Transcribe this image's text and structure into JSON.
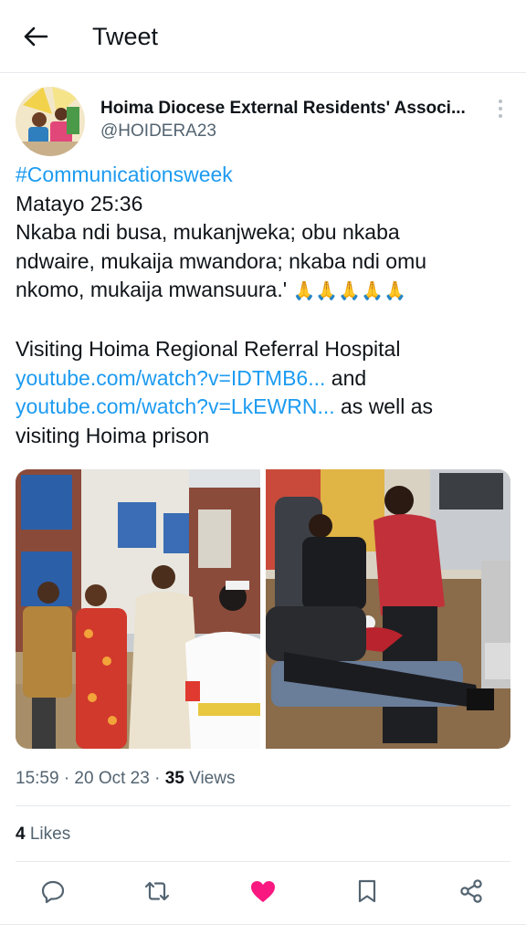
{
  "header": {
    "title": "Tweet",
    "back_icon": "arrow-left-icon"
  },
  "author": {
    "name": "Hoima Diocese External Residents' Associ...",
    "handle": "@HOIDERA23"
  },
  "tweet": {
    "hashtag": "#Communicationsweek",
    "line1": "Matayo 25:36",
    "line2": "Nkaba ndi busa, mukanjweka; obu nkaba",
    "line3": "ndwaire, mukaija mwandora; nkaba ndi omu",
    "line4": "nkomo, mukaija mwansuura.'",
    "emoji": "🙏🙏🙏🙏🙏",
    "line5": " Visiting Hoima Regional Referral Hospital",
    "link1": "youtube.com/watch?v=IDTMB6...",
    "after_link1": " and",
    "link2": "youtube.com/watch?v=LkEWRN...",
    "after_link2": " as well as",
    "line8": "visiting  Hoima prison"
  },
  "meta": {
    "time_date": "15:59 · 20 Oct 23 · ",
    "views_count": "35",
    "views_label": " Views"
  },
  "likes": {
    "count": "4",
    "label": " Likes"
  },
  "actions": {
    "reply_icon": "reply-icon",
    "retweet_icon": "retweet-icon",
    "like_icon": "heart-icon",
    "bookmark_icon": "bookmark-icon",
    "share_icon": "share-icon"
  },
  "colors": {
    "link": "#1d9bf0",
    "like": "#f91880",
    "muted": "#536471",
    "text": "#0f1419"
  }
}
